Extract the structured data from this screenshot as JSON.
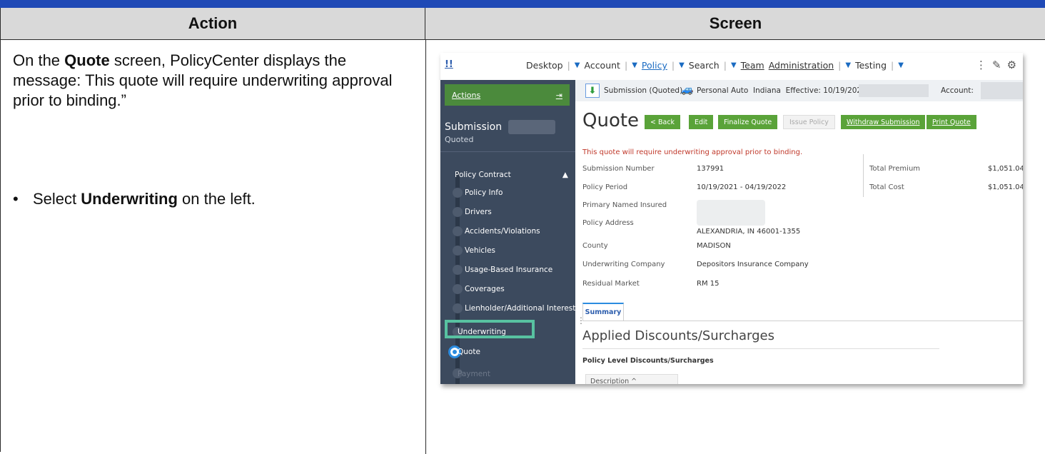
{
  "table": {
    "action_header": "Action",
    "screen_header": "Screen"
  },
  "action": {
    "para_pre": "On the ",
    "para_bold": "Quote",
    "para_post": " screen, PolicyCenter displays the message: This quote will require underwriting approval prior to binding.”",
    "bullet_pre": "Select ",
    "bullet_bold": "Underwriting",
    "bullet_post": " on the left."
  },
  "app": {
    "logo": "!!",
    "nav": {
      "desktop": "Desktop",
      "account": "Account",
      "policy": "Policy",
      "search": "Search",
      "team": "Team",
      "administration": "Administration",
      "testing": "Testing"
    },
    "icons": [
      "more-vert-icon",
      "edit-icon",
      "settings-icon"
    ],
    "sidebar": {
      "actions_label": "Actions",
      "submission_title": "Submission",
      "submission_status": "Quoted",
      "section_label": "Policy Contract",
      "items": [
        "Policy Info",
        "Drivers",
        "Accidents/Violations",
        "Vehicles",
        "Usage-Based Insurance",
        "Coverages",
        "Lienholder/Additional Interest",
        "Underwriting",
        "Quote",
        "Payment"
      ]
    },
    "crumb": {
      "submission": "Submission (Quoted)",
      "product": "Personal Auto",
      "state": "Indiana",
      "effective": "Effective: 10/19/2021",
      "account": "Account:"
    },
    "quote": {
      "title": "Quote",
      "buttons": {
        "back": "< Back",
        "edit": "Edit",
        "finalize": "Finalize Quote",
        "issue": "Issue Policy",
        "withdraw": "Withdraw Submission",
        "print": "Print Quote"
      },
      "warning": "This quote will require underwriting approval prior to binding.",
      "fields": {
        "submission_number_label": "Submission Number",
        "submission_number": "137991",
        "policy_period_label": "Policy Period",
        "policy_period": "10/19/2021 - 04/19/2022",
        "primary_insured_label": "Primary Named Insured",
        "policy_address_label": "Policy Address",
        "policy_address": "ALEXANDRIA, IN 46001-1355",
        "county_label": "County",
        "county": "MADISON",
        "uw_company_label": "Underwriting Company",
        "uw_company": "Depositors Insurance Company",
        "residual_label": "Residual Market",
        "residual": "RM 15",
        "total_premium_label": "Total Premium",
        "total_premium": "$1,051.04",
        "total_cost_label": "Total Cost",
        "total_cost": "$1,051.04"
      },
      "tab_summary": "Summary",
      "applied_title": "Applied Discounts/Surcharges",
      "policy_level": "Policy Level Discounts/Surcharges",
      "description_col": "Description ^"
    }
  },
  "colors": {
    "top_bar": "#1f49b6",
    "sidebar": "#3c4a5e",
    "green_button": "#5aa339",
    "highlight": "#58c2a1",
    "warning": "#c0392b"
  }
}
